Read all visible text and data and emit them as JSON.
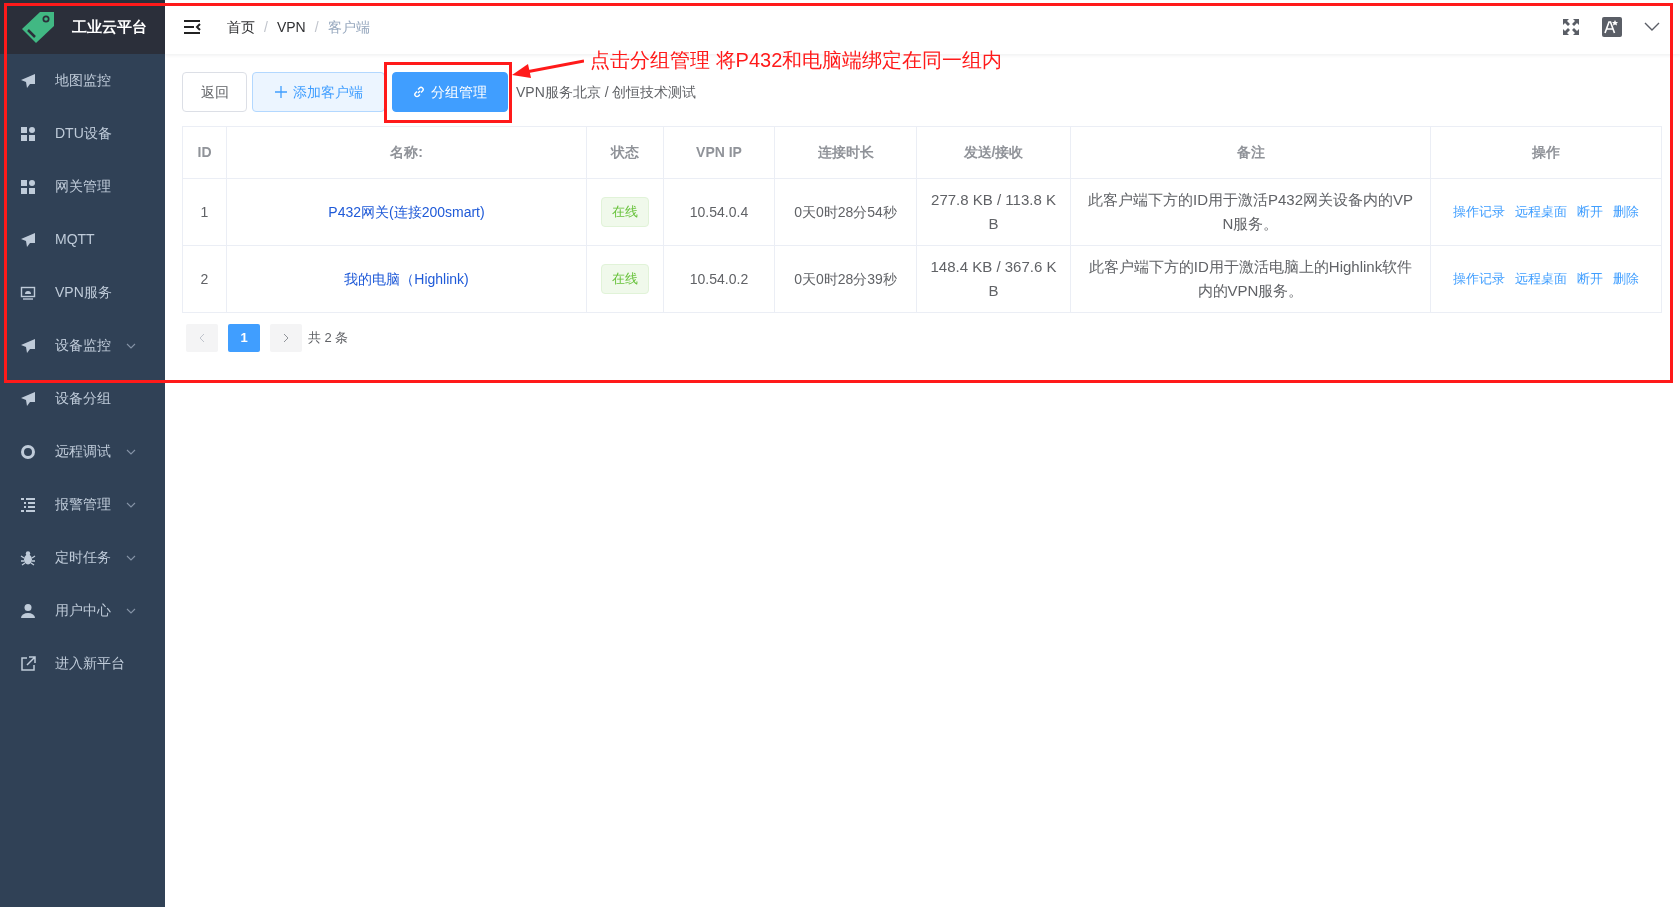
{
  "sidebar": {
    "logo_text": "工业云平台",
    "items": [
      {
        "label": "地图监控",
        "has_submenu": false
      },
      {
        "label": "DTU设备",
        "has_submenu": false
      },
      {
        "label": "网关管理",
        "has_submenu": false
      },
      {
        "label": "MQTT",
        "has_submenu": false
      },
      {
        "label": "VPN服务",
        "has_submenu": false
      },
      {
        "label": "设备监控",
        "has_submenu": true
      },
      {
        "label": "设备分组",
        "has_submenu": false
      },
      {
        "label": "远程调试",
        "has_submenu": true
      },
      {
        "label": "报警管理",
        "has_submenu": true
      },
      {
        "label": "定时任务",
        "has_submenu": true
      },
      {
        "label": "用户中心",
        "has_submenu": true
      },
      {
        "label": "进入新平台",
        "has_submenu": false
      }
    ]
  },
  "breadcrumb": [
    "首页",
    "VPN",
    "客户端"
  ],
  "breadcrumb_separator": "/",
  "toolbar": {
    "buttons": [
      {
        "label": "返回",
        "kind": "plain"
      },
      {
        "label": "添加客户端",
        "kind": "add"
      },
      {
        "label": "分组管理",
        "kind": "primary"
      }
    ],
    "path": "VPN服务北京 / 创恒技术测试"
  },
  "table": {
    "columns": [
      "ID",
      "名称:",
      "状态",
      "VPN IP",
      "连接时长",
      "发送/接收",
      "备注",
      "操作"
    ],
    "rows": [
      {
        "id": "1",
        "name": "P432网关(连接200smart)",
        "status": "在线",
        "vpn_ip": "10.54.0.4",
        "duration": "0天0时28分54秒",
        "traffic": "277.8 KB / 113.8 KB",
        "note": "此客户端下方的ID用于激活P432网关设备内的VPN服务。",
        "actions": [
          "操作记录",
          "远程桌面",
          "断开",
          "删除"
        ]
      },
      {
        "id": "2",
        "name": "我的电脑（Highlink)",
        "status": "在线",
        "vpn_ip": "10.54.0.2",
        "duration": "0天0时28分39秒",
        "traffic": "148.4 KB / 367.6 KB",
        "note": "此客户端下方的ID用于激活电脑上的Highlink软件内的VPN服务。",
        "actions": [
          "操作记录",
          "远程桌面",
          "断开",
          "删除"
        ]
      }
    ]
  },
  "pagination": {
    "pages": [
      {
        "label": "1",
        "selected": true
      }
    ],
    "total": "共 2 条"
  },
  "annotation": {
    "text": "点击分组管理 将P432和电脑端绑定在同一组内"
  }
}
